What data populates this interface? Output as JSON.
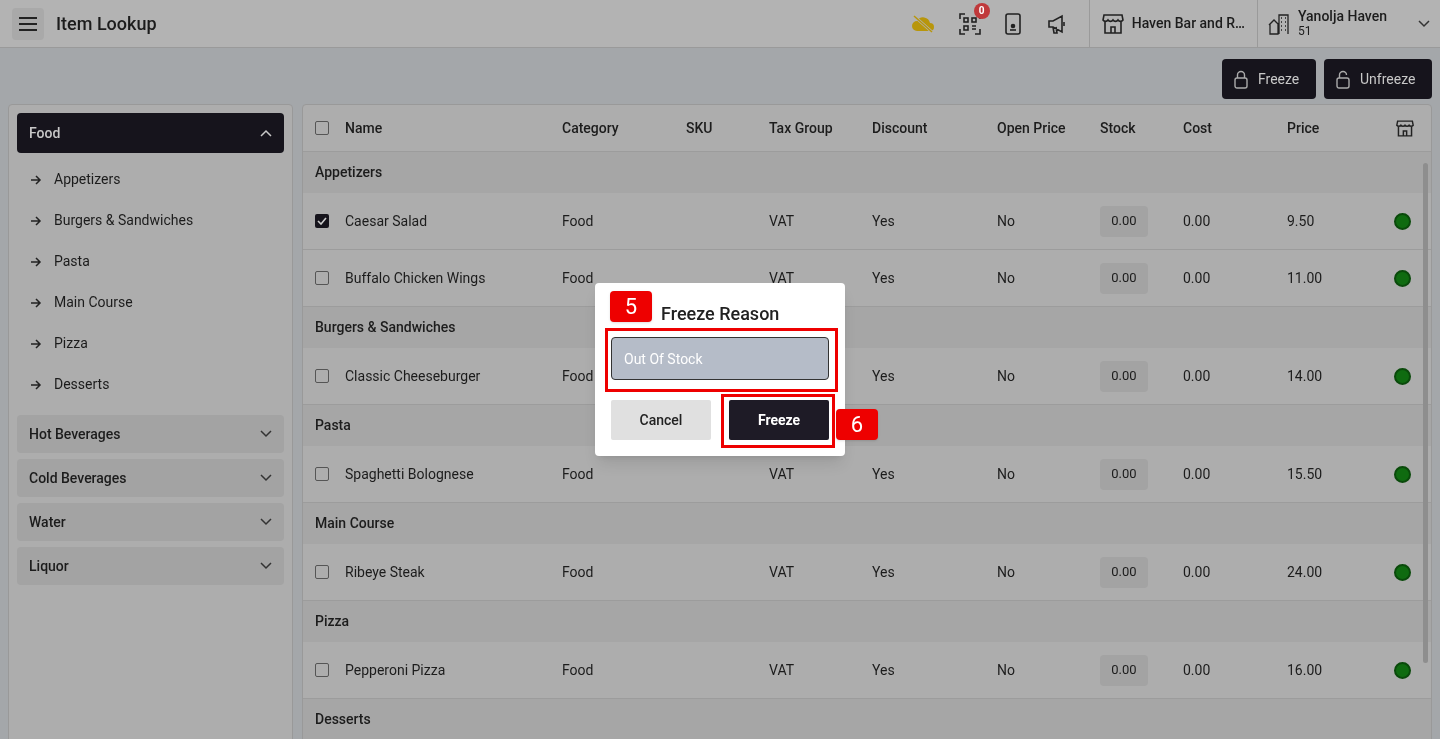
{
  "header": {
    "title": "Item Lookup",
    "qr_badge": "0",
    "store": "Haven Bar and R…",
    "account": {
      "name": "Yanolja Haven",
      "number": "51"
    }
  },
  "actions": [
    {
      "label": "Freeze",
      "kind": "lock"
    },
    {
      "label": "Unfreeze",
      "kind": "unlock"
    }
  ],
  "sidebar": {
    "categories": [
      {
        "label": "Food",
        "selected": true,
        "expanded": true,
        "children": [
          {
            "label": "Appetizers"
          },
          {
            "label": "Burgers & Sandwiches"
          },
          {
            "label": "Pasta"
          },
          {
            "label": "Main Course"
          },
          {
            "label": "Pizza"
          },
          {
            "label": "Desserts"
          }
        ]
      },
      {
        "label": "Hot Beverages",
        "selected": false,
        "expanded": false
      },
      {
        "label": "Cold Beverages",
        "selected": false,
        "expanded": false
      },
      {
        "label": "Water",
        "selected": false,
        "expanded": false
      },
      {
        "label": "Liquor",
        "selected": false,
        "expanded": false
      }
    ]
  },
  "table": {
    "select_all": false,
    "columns": [
      "Name",
      "Category",
      "SKU",
      "Tax Group",
      "Discount",
      "Open Price",
      "Stock",
      "Cost",
      "Price"
    ],
    "rows": [
      {
        "kind": "group",
        "label": "Appetizers"
      },
      {
        "kind": "item",
        "checked": true,
        "name": "Caesar Salad",
        "category": "Food",
        "tax_group": "VAT",
        "discount": "Yes",
        "open_price": "No",
        "stock": "0.00",
        "cost": "0.00",
        "price": "9.50",
        "active": true
      },
      {
        "kind": "item",
        "checked": false,
        "name": "Buffalo Chicken Wings",
        "category": "Food",
        "tax_group": "VAT",
        "discount": "Yes",
        "open_price": "No",
        "stock": "0.00",
        "cost": "0.00",
        "price": "11.00",
        "active": true
      },
      {
        "kind": "group",
        "label": "Burgers & Sandwiches"
      },
      {
        "kind": "item",
        "checked": false,
        "name": "Classic Cheeseburger",
        "category": "Food",
        "discount": "Yes",
        "open_price": "No",
        "stock": "0.00",
        "cost": "0.00",
        "price": "14.00",
        "active": true
      },
      {
        "kind": "group",
        "label": "Pasta"
      },
      {
        "kind": "item",
        "checked": false,
        "name": "Spaghetti Bolognese",
        "category": "Food",
        "tax_group": "VAT",
        "discount": "Yes",
        "open_price": "No",
        "stock": "0.00",
        "cost": "0.00",
        "price": "15.50",
        "active": true
      },
      {
        "kind": "group",
        "label": "Main Course"
      },
      {
        "kind": "item",
        "checked": false,
        "name": "Ribeye Steak",
        "category": "Food",
        "tax_group": "VAT",
        "discount": "Yes",
        "open_price": "No",
        "stock": "0.00",
        "cost": "0.00",
        "price": "24.00",
        "active": true
      },
      {
        "kind": "group",
        "label": "Pizza"
      },
      {
        "kind": "item",
        "checked": false,
        "name": "Pepperoni Pizza",
        "category": "Food",
        "tax_group": "VAT",
        "discount": "Yes",
        "open_price": "No",
        "stock": "0.00",
        "cost": "0.00",
        "price": "16.00",
        "active": true
      },
      {
        "kind": "group",
        "label": "Desserts"
      }
    ]
  },
  "dialog": {
    "title": "Freeze Reason",
    "value": "Out Of Stock",
    "buttons": [
      {
        "label": "Cancel",
        "kind": "secondary"
      },
      {
        "label": "Freeze",
        "kind": "primary"
      }
    ],
    "annotations": [
      "5",
      "6"
    ]
  }
}
